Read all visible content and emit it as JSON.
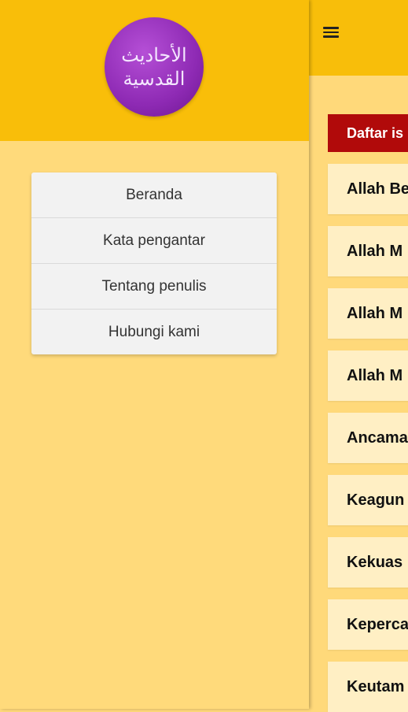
{
  "main": {
    "menu_icon": "hamburger-menu-icon",
    "section_label": "Daftar is",
    "items": [
      {
        "label": "Allah Be"
      },
      {
        "label": "Allah M"
      },
      {
        "label": "Allah M"
      },
      {
        "label": "Allah M"
      },
      {
        "label": "Ancama"
      },
      {
        "label": "Keagun"
      },
      {
        "label": "Kekuas"
      },
      {
        "label": "Keperca"
      },
      {
        "label": "Keutam"
      }
    ]
  },
  "drawer": {
    "logo": {
      "line1": "الأحاديث",
      "line2": "القدسية"
    },
    "menu": [
      {
        "label": "Beranda"
      },
      {
        "label": "Kata pengantar"
      },
      {
        "label": "Tentang penulis"
      },
      {
        "label": "Hubungi kami"
      }
    ]
  },
  "colors": {
    "header": "#F8BE0A",
    "background": "#FFD97A",
    "section_label_bg": "#B10A0A",
    "logo": "#8E2AB4"
  }
}
